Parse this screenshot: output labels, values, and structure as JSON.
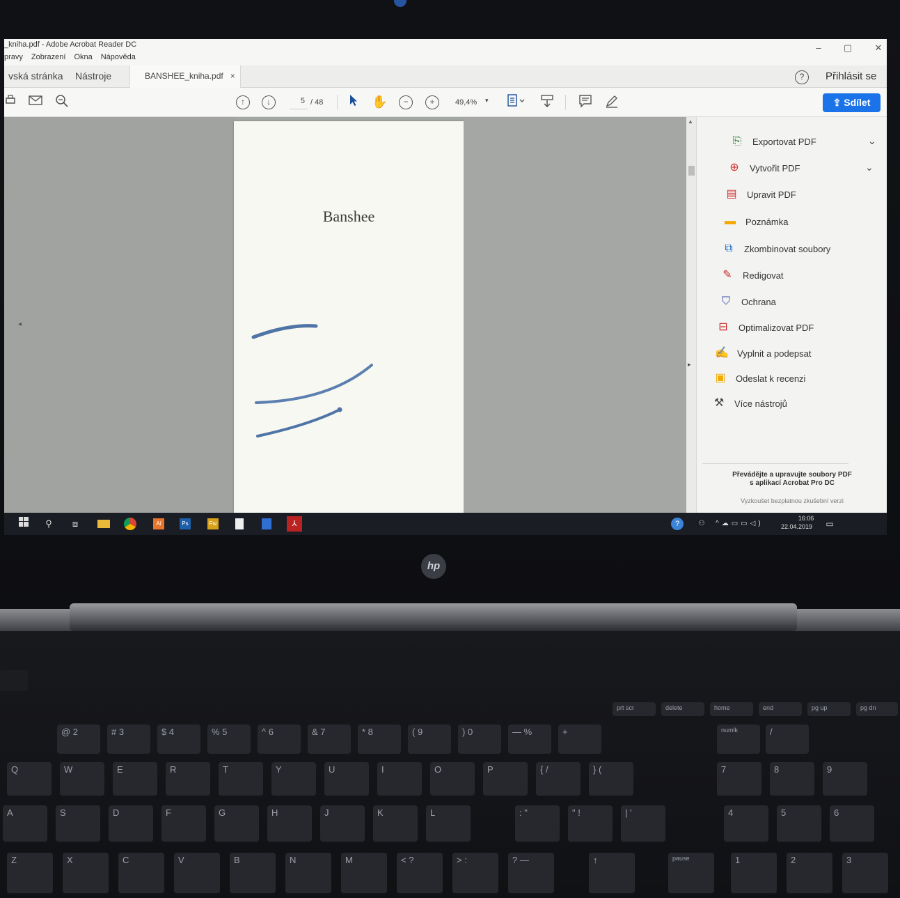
{
  "window": {
    "app_title": "_kniha.pdf - Adobe Acrobat Reader DC",
    "menu": [
      "pravy",
      "Zobrazení",
      "Okna",
      "Nápověda"
    ],
    "controls": {
      "minimize": "–",
      "restore": "▢",
      "close": "✕"
    }
  },
  "tabs": {
    "home": "vská stránka",
    "tools": "Nástroje",
    "document": "BANSHEE_kniha.pdf",
    "close": "×"
  },
  "header": {
    "help": "?",
    "signin": "Přihlásit se"
  },
  "toolbar": {
    "page_current": "5",
    "page_total": "/ 48",
    "zoom": "49,4%",
    "zoom_caret": "▾",
    "share": "Sdílet"
  },
  "document": {
    "page_title": "Banshee"
  },
  "tools_pane": {
    "items": [
      {
        "label": "Exportovat PDF",
        "icon": "export-pdf-icon"
      },
      {
        "label": "Vytvořit PDF",
        "icon": "create-pdf-icon"
      },
      {
        "label": "Upravit PDF",
        "icon": "edit-pdf-icon"
      },
      {
        "label": "Poznámka",
        "icon": "comment-icon"
      },
      {
        "label": "Zkombinovat soubory",
        "icon": "combine-files-icon"
      },
      {
        "label": "Redigovat",
        "icon": "redact-icon"
      },
      {
        "label": "Ochrana",
        "icon": "shield-icon"
      },
      {
        "label": "Optimalizovat PDF",
        "icon": "optimize-pdf-icon"
      },
      {
        "label": "Vyplnit a podepsat",
        "icon": "sign-icon"
      },
      {
        "label": "Odeslat k recenzi",
        "icon": "send-review-icon"
      },
      {
        "label": "Více nástrojů",
        "icon": "more-tools-icon"
      }
    ],
    "promo_line1": "Převádějte a upravujte soubory PDF",
    "promo_line2": "s aplikací Acrobat Pro DC",
    "trial": "Vyzkoušet bezplatnou zkušební verzi"
  },
  "taskbar": {
    "time": "16:06",
    "date": "22.04.2019"
  },
  "laptop": {
    "logo": "hp"
  },
  "keyboard": {
    "row1": [
      "prt scr",
      "delete",
      "home",
      "end",
      "pg up",
      "pg dn"
    ],
    "row2": [
      "@ 2",
      "# 3",
      "$ 4",
      "% 5",
      "^ 6",
      "& 7",
      "* 8",
      "( 9",
      ") 0",
      "— %",
      "+",
      "numlk",
      "/"
    ],
    "row3": [
      "Q",
      "W",
      "E",
      "R",
      "T",
      "Y",
      "U",
      "I",
      "O",
      "P",
      "{ /",
      "} (",
      "7",
      "8",
      "9"
    ],
    "row4": [
      "A",
      "S",
      "D",
      "F",
      "G",
      "H",
      "J",
      "K",
      "L",
      ": \"",
      "\" !",
      "| '",
      "4",
      "5",
      "6"
    ],
    "row5": [
      "Z",
      "X",
      "C",
      "V",
      "B",
      "N",
      "M",
      "< ?",
      "> :",
      "? —",
      "↑",
      "pause",
      "1",
      "2",
      "3"
    ]
  }
}
